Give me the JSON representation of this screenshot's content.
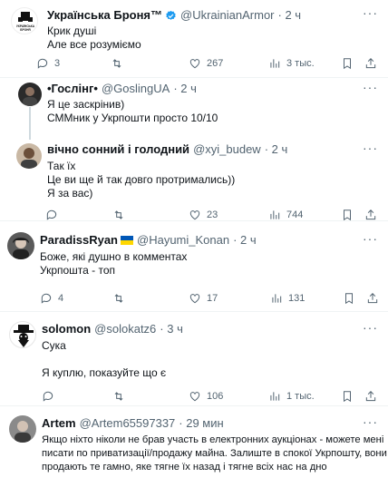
{
  "tweets": [
    {
      "name": "Українська Броня™",
      "handle": "@UkrainianArmor",
      "time": "· 2 ч",
      "lines": [
        "Крик душі",
        "Але все розуміємо"
      ],
      "reply": "3",
      "retweet": "",
      "like": "267",
      "views": "3 тыс.",
      "avatar_text": "УКРАЇНСЬКА БРОНЯ"
    },
    {
      "name": "•Гослінг•",
      "handle": "@GoslingUA",
      "time": "· 2 ч",
      "lines": [
        "Я це заскрінив)",
        "СММник у Укрпошти просто 10/10"
      ]
    },
    {
      "name": "вічно сонний і голодний",
      "handle": "@xyi_budew",
      "time": "· 2 ч",
      "lines": [
        "Так їх",
        "Це ви ще й так довго протримались))",
        "Я за вас)"
      ],
      "reply": "",
      "retweet": "",
      "like": "23",
      "views": "744"
    },
    {
      "name": "ParadissRyan",
      "handle": "@Hayumi_Konan",
      "time": "· 2 ч",
      "lines": [
        "Боже, які душно в комментах",
        "Укрпошта - топ"
      ],
      "reply": "4",
      "retweet": "",
      "like": "17",
      "views": "131"
    },
    {
      "name": "solomon",
      "handle": "@solokatz6",
      "time": "· 3 ч",
      "lines": [
        "Сука",
        "",
        "Я куплю, показуйте що є"
      ],
      "reply": "",
      "retweet": "",
      "like": "106",
      "views": "1 тыс."
    },
    {
      "name": "Artem",
      "handle": "@Artem65597337",
      "time": "· 29 мин",
      "lines": [
        "Якщо ніхто ніколи не брав участь в електронних аукціонах - можете мені",
        "писати по приватизації/продажу майна. Залиште в спокої Укрпошту, вони",
        "продають те гамно, яке тягне їх назад і тягне всіх нас на дно"
      ]
    }
  ],
  "colors": {
    "accent": "#1d9bf0",
    "muted": "#536471",
    "text": "#0f1419",
    "divider": "#eff3f4"
  },
  "icons": [
    "reply-icon",
    "retweet-icon",
    "like-icon",
    "views-icon",
    "bookmark-icon",
    "share-icon",
    "more-icon",
    "verified-badge-icon"
  ]
}
